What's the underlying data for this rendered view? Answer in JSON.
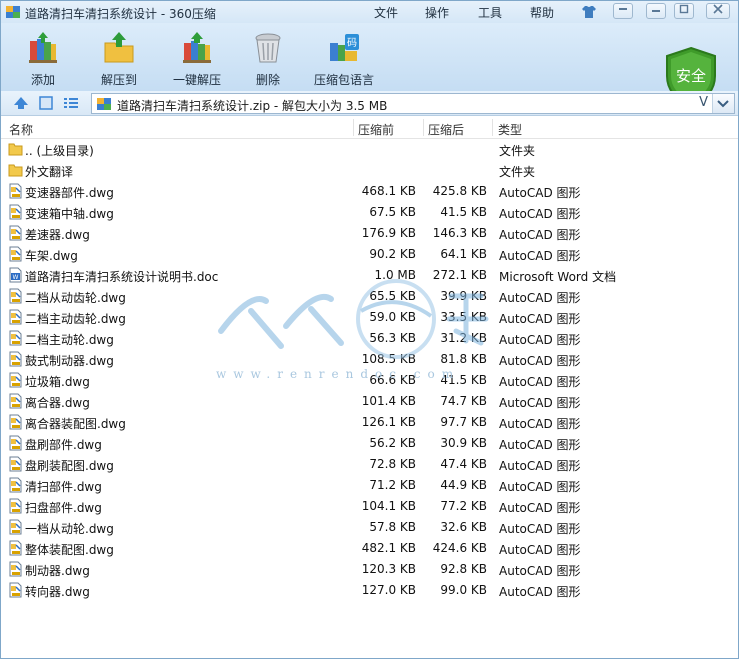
{
  "window": {
    "title": "道路清扫车清扫系统设计 - 360压缩",
    "menu": [
      "文件",
      "操作",
      "工具",
      "帮助"
    ],
    "controls": [
      "shirt",
      "minimize-small",
      "minimize",
      "maximize",
      "close"
    ]
  },
  "toolbar": {
    "buttons": [
      {
        "label": "添加",
        "icon": "add-books-icon"
      },
      {
        "label": "解压到",
        "icon": "extract-folder-icon"
      },
      {
        "label": "一键解压",
        "icon": "one-click-extract-icon"
      },
      {
        "label": "删除",
        "icon": "trash-can-icon"
      },
      {
        "label": "压缩包语言",
        "icon": "code-language-icon"
      }
    ],
    "security_badge": "安全"
  },
  "addressbar": {
    "path_text": "道路清扫车清扫系统设计.zip - 解包大小为 3.5 MB",
    "dropdown_glyph": "V"
  },
  "columns": {
    "name": "名称",
    "size": "压缩前",
    "compressed": "压缩后",
    "type": "类型"
  },
  "files": [
    {
      "name": ".. (上级目录)",
      "size": "",
      "compressed": "",
      "type": "文件夹",
      "icon": "folder-icon"
    },
    {
      "name": "外文翻译",
      "size": "",
      "compressed": "",
      "type": "文件夹",
      "icon": "folder-icon"
    },
    {
      "name": "变速器部件.dwg",
      "size": "468.1 KB",
      "compressed": "425.8 KB",
      "type": "AutoCAD 图形",
      "icon": "dwg-file-icon"
    },
    {
      "name": "变速箱中轴.dwg",
      "size": "67.5 KB",
      "compressed": "41.5 KB",
      "type": "AutoCAD 图形",
      "icon": "dwg-file-icon"
    },
    {
      "name": "差速器.dwg",
      "size": "176.9 KB",
      "compressed": "146.3 KB",
      "type": "AutoCAD 图形",
      "icon": "dwg-file-icon"
    },
    {
      "name": "车架.dwg",
      "size": "90.2 KB",
      "compressed": "64.1 KB",
      "type": "AutoCAD 图形",
      "icon": "dwg-file-icon"
    },
    {
      "name": "道路清扫车清扫系统设计说明书.doc",
      "size": "1.0 MB",
      "compressed": "272.1 KB",
      "type": "Microsoft Word 文档",
      "icon": "word-file-icon"
    },
    {
      "name": "二档从动齿轮.dwg",
      "size": "65.5 KB",
      "compressed": "39.9 KB",
      "type": "AutoCAD 图形",
      "icon": "dwg-file-icon"
    },
    {
      "name": "二档主动齿轮.dwg",
      "size": "59.0 KB",
      "compressed": "33.5 KB",
      "type": "AutoCAD 图形",
      "icon": "dwg-file-icon"
    },
    {
      "name": "二档主动轮.dwg",
      "size": "56.3 KB",
      "compressed": "31.2 KB",
      "type": "AutoCAD 图形",
      "icon": "dwg-file-icon"
    },
    {
      "name": "鼓式制动器.dwg",
      "size": "108.5 KB",
      "compressed": "81.8 KB",
      "type": "AutoCAD 图形",
      "icon": "dwg-file-icon"
    },
    {
      "name": "垃圾箱.dwg",
      "size": "66.6 KB",
      "compressed": "41.5 KB",
      "type": "AutoCAD 图形",
      "icon": "dwg-file-icon"
    },
    {
      "name": "离合器.dwg",
      "size": "101.4 KB",
      "compressed": "74.7 KB",
      "type": "AutoCAD 图形",
      "icon": "dwg-file-icon"
    },
    {
      "name": "离合器装配图.dwg",
      "size": "126.1 KB",
      "compressed": "97.7 KB",
      "type": "AutoCAD 图形",
      "icon": "dwg-file-icon"
    },
    {
      "name": "盘刷部件.dwg",
      "size": "56.2 KB",
      "compressed": "30.9 KB",
      "type": "AutoCAD 图形",
      "icon": "dwg-file-icon"
    },
    {
      "name": "盘刷装配图.dwg",
      "size": "72.8 KB",
      "compressed": "47.4 KB",
      "type": "AutoCAD 图形",
      "icon": "dwg-file-icon"
    },
    {
      "name": "清扫部件.dwg",
      "size": "71.2 KB",
      "compressed": "44.9 KB",
      "type": "AutoCAD 图形",
      "icon": "dwg-file-icon"
    },
    {
      "name": "扫盘部件.dwg",
      "size": "104.1 KB",
      "compressed": "77.2 KB",
      "type": "AutoCAD 图形",
      "icon": "dwg-file-icon"
    },
    {
      "name": "一档从动轮.dwg",
      "size": "57.8 KB",
      "compressed": "32.6 KB",
      "type": "AutoCAD 图形",
      "icon": "dwg-file-icon"
    },
    {
      "name": "整体装配图.dwg",
      "size": "482.1 KB",
      "compressed": "424.6 KB",
      "type": "AutoCAD 图形",
      "icon": "dwg-file-icon"
    },
    {
      "name": "制动器.dwg",
      "size": "120.3 KB",
      "compressed": "92.8 KB",
      "type": "AutoCAD 图形",
      "icon": "dwg-file-icon"
    },
    {
      "name": "转向器.dwg",
      "size": "127.0 KB",
      "compressed": "99.0 KB",
      "type": "AutoCAD 图形",
      "icon": "dwg-file-icon"
    }
  ],
  "watermark": {
    "url": "www.renrendoc.com"
  },
  "colors": {
    "toolbar_top": "#dcecfa",
    "toolbar_bottom": "#c5ddf3",
    "shield_green": "#3f9b2a",
    "folder_yellow": "#f2c94c"
  }
}
